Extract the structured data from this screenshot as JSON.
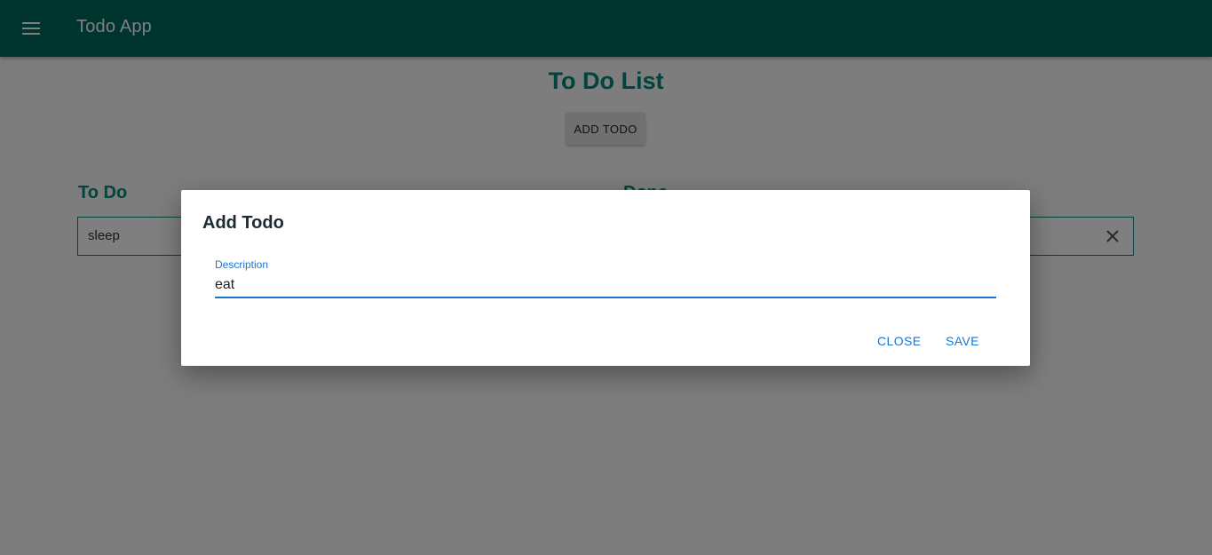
{
  "appbar": {
    "title": "Todo App",
    "menu_icon": "menu-icon",
    "color": "#00695c"
  },
  "main": {
    "title": "To Do List",
    "add_button_label": "ADD TODO"
  },
  "columns": {
    "todo": {
      "heading": "To Do",
      "items": [
        {
          "text": "sleep"
        }
      ]
    },
    "done": {
      "heading": "Done",
      "items": [
        {
          "text": "",
          "close_icon": "close-icon"
        }
      ]
    }
  },
  "dialog": {
    "title": "Add Todo",
    "field_label": "Description",
    "field_value": "eat",
    "close_label": "CLOSE",
    "save_label": "SAVE",
    "accent": "#1976d2"
  },
  "colors": {
    "heading": "#00897b"
  }
}
